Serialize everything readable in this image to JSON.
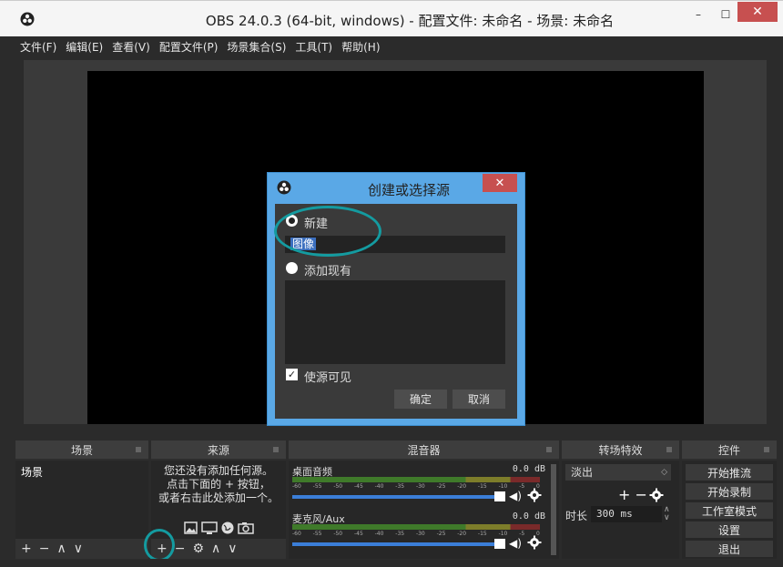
{
  "window": {
    "title": "OBS 24.0.3 (64-bit, windows) - 配置文件: 未命名 - 场景: 未命名",
    "minimize": "–",
    "maximize": "☐",
    "close": "✕"
  },
  "menu": {
    "items": [
      "文件(F)",
      "编辑(E)",
      "查看(V)",
      "配置文件(P)",
      "场景集合(S)",
      "工具(T)",
      "帮助(H)"
    ]
  },
  "dialog": {
    "title": "创建或选择源",
    "close": "✕",
    "option_new": "新建",
    "name_value": "图像",
    "option_existing": "添加现有",
    "make_visible": "使源可见",
    "make_visible_checked": true,
    "ok": "确定",
    "cancel": "取消"
  },
  "docks": {
    "scenes": {
      "title": "场景",
      "items": [
        "场景"
      ],
      "toolbar": [
        "+",
        "−",
        "∧",
        "∨"
      ]
    },
    "sources": {
      "title": "来源",
      "empty_line1": "您还没有添加任何源。",
      "empty_line2": "点击下面的 + 按钮，",
      "empty_line3": "或者右击此处添加一个。",
      "toolbar": [
        "+",
        "−",
        "⚙",
        "∧",
        "∨"
      ]
    },
    "mixer": {
      "title": "混音器",
      "channels": [
        {
          "name": "桌面音频",
          "db": "0.0 dB"
        },
        {
          "name": "麦克风/Aux",
          "db": "0.0 dB"
        }
      ],
      "scale": [
        "-60",
        "-55",
        "-50",
        "-45",
        "-40",
        "-35",
        "-30",
        "-25",
        "-20",
        "-15",
        "-10",
        "-5",
        "0"
      ]
    },
    "transitions": {
      "title": "转场特效",
      "selected": "淡出",
      "add_remove": "+ −",
      "duration_label": "时长",
      "duration": "300 ms"
    },
    "controls": {
      "title": "控件",
      "buttons": [
        "开始推流",
        "开始录制",
        "工作室模式",
        "设置",
        "退出"
      ]
    }
  },
  "colors": {
    "accent_blue": "#5aa8e6",
    "highlight_teal": "#149ba0",
    "close_red": "#c75050"
  }
}
